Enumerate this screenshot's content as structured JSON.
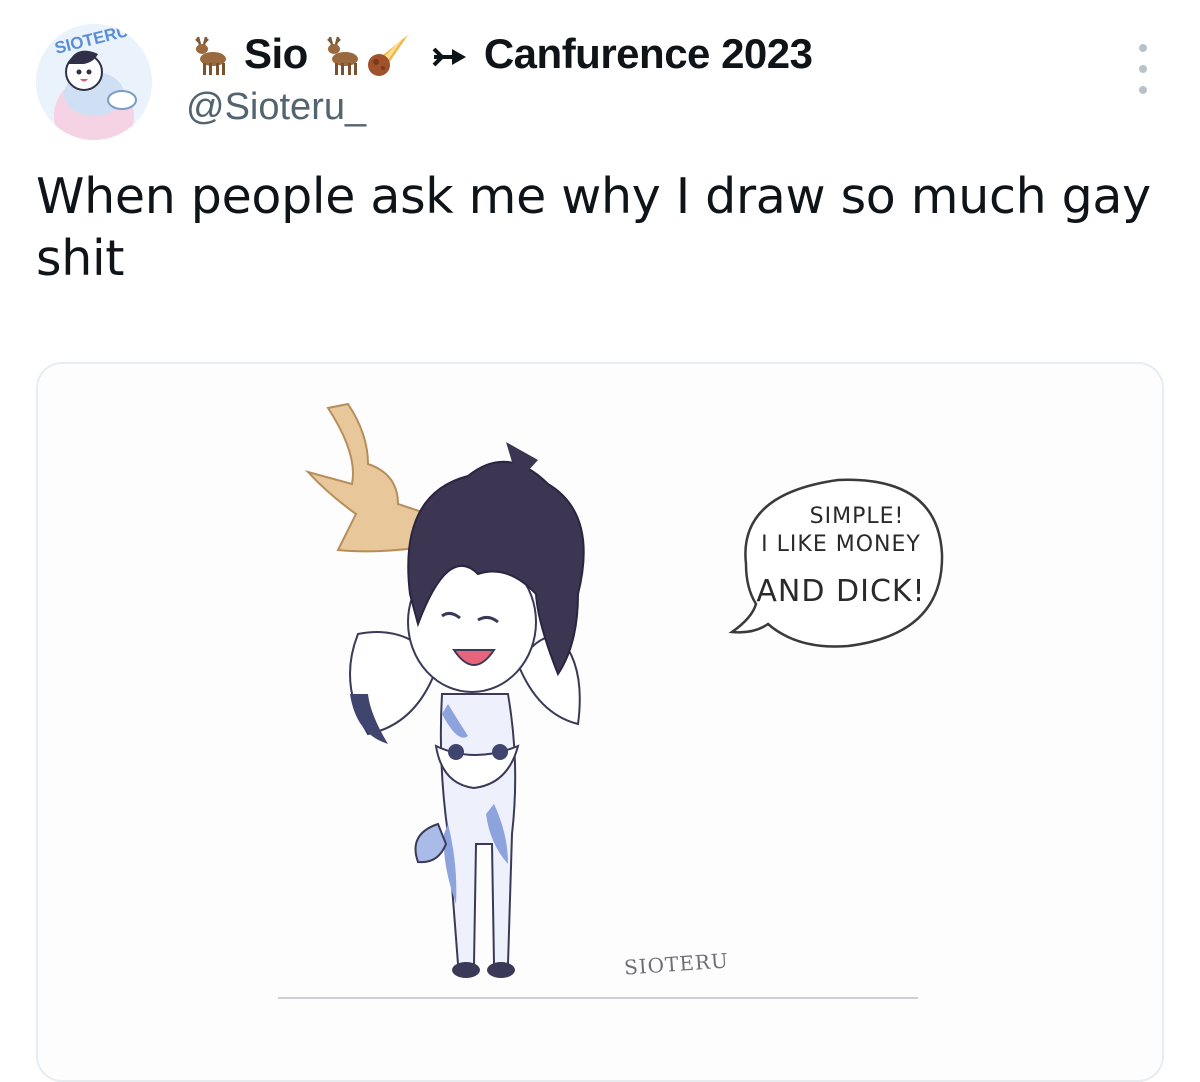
{
  "header": {
    "avatar_text": "SIOTERU",
    "display_name": "Sio",
    "event_name": "Canfurence 2023",
    "handle": "@Sioteru_",
    "icons": [
      "deer-emoji",
      "deer-emoji",
      "comet-emoji",
      "arrow-icon",
      "more-options-icon"
    ]
  },
  "tweet": {
    "text": "When people ask me why I draw so much gay shit"
  },
  "media": {
    "bubble_line1": "SIMPLE!",
    "bubble_line2": "I LIKE MONEY",
    "bubble_line3": "AND DICK!",
    "signature": "SIOTERU"
  },
  "colors": {
    "text": "#0f1419",
    "secondary_text": "#536471",
    "border": "#e6ecf0"
  }
}
